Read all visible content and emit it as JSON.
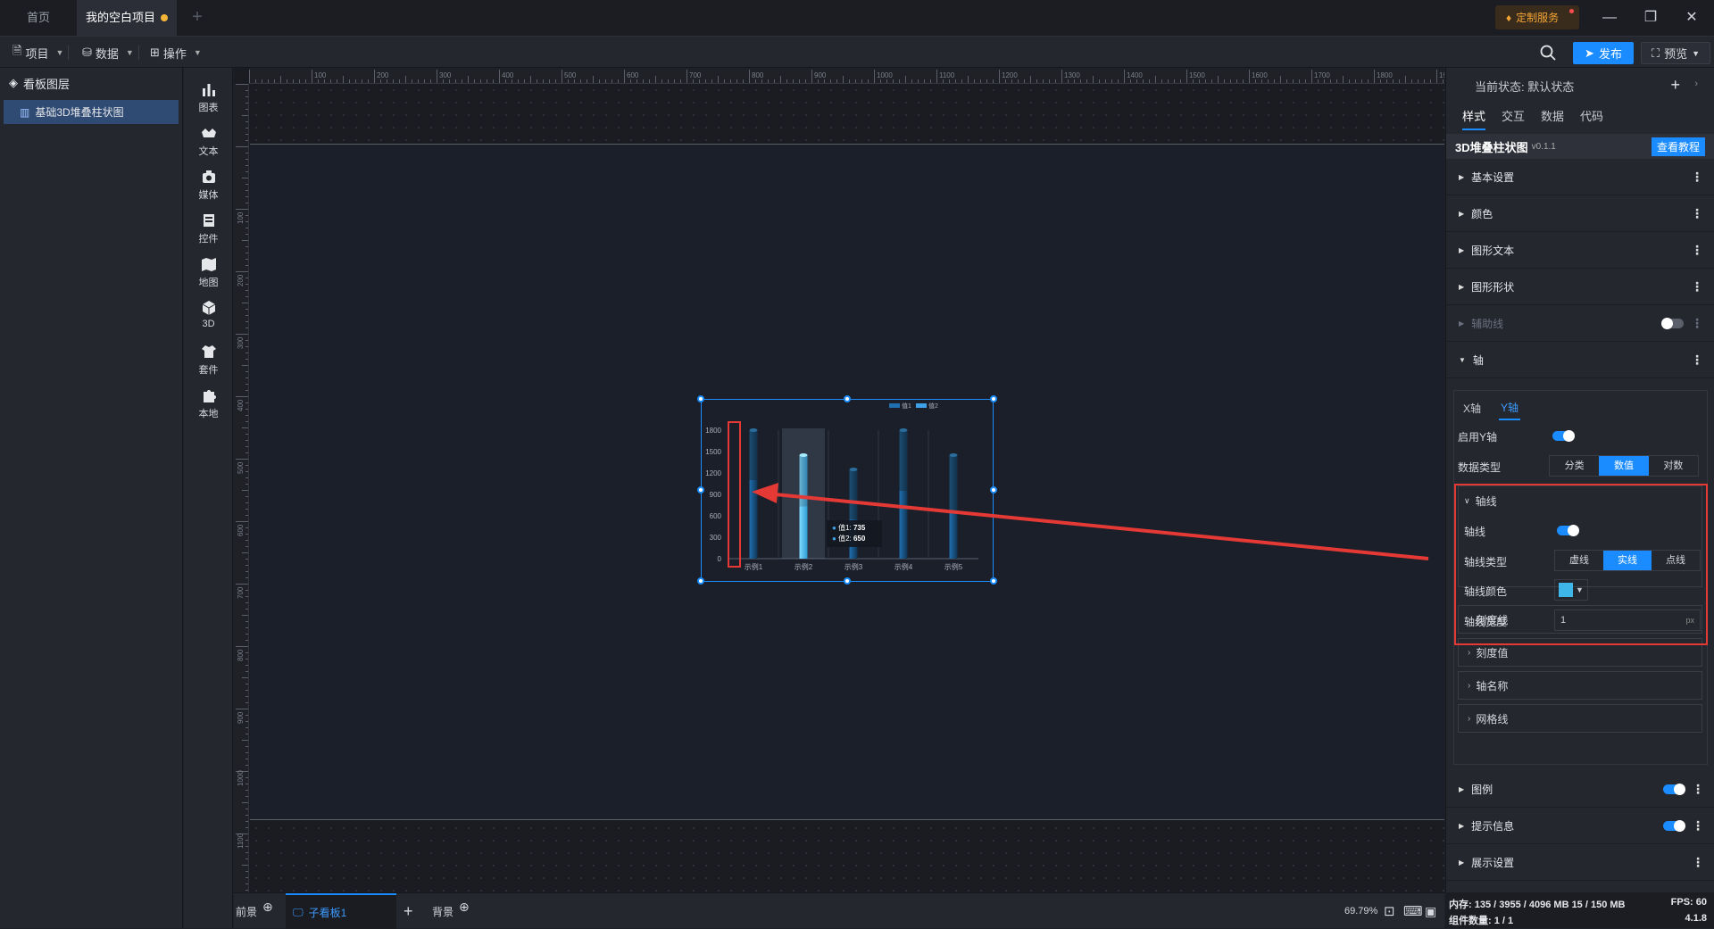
{
  "tabs": {
    "home": "首页",
    "project": "我的空白项目"
  },
  "header": {
    "custom_service": "定制服务",
    "publish": "发布",
    "preview": "预览"
  },
  "toolbar": {
    "project": "项目",
    "data": "数据",
    "operate": "操作"
  },
  "layers": {
    "title": "看板图层",
    "item": "基础3D堆叠柱状图"
  },
  "components": [
    "图表",
    "文本",
    "媒体",
    "控件",
    "地图",
    "3D",
    "套件",
    "本地"
  ],
  "ruler": {
    "top": [
      "100",
      "200",
      "300",
      "400",
      "500",
      "600",
      "700",
      "800",
      "900",
      "1000",
      "1100",
      "1200",
      "1300",
      "1400",
      "1500",
      "1600",
      "1700",
      "1800",
      "1900"
    ],
    "left": [
      "100",
      "200",
      "300",
      "400",
      "500",
      "600",
      "700",
      "800",
      "900",
      "1000",
      "1100",
      "1200"
    ]
  },
  "chart_data": {
    "type": "bar",
    "categories": [
      "示例1",
      "示例2",
      "示例3",
      "示例4",
      "示例5"
    ],
    "series": [
      {
        "name": "值1",
        "values": [
          1100,
          735,
          550,
          950,
          650
        ]
      },
      {
        "name": "值2",
        "values": [
          1800,
          1450,
          1250,
          1800,
          1450
        ]
      }
    ],
    "yticks": [
      "1800",
      "1500",
      "1200",
      "900",
      "600",
      "300",
      "0"
    ],
    "ylim": [
      0,
      1800
    ],
    "legend": [
      "值1",
      "值2"
    ],
    "tooltip": {
      "label1": "值1:",
      "value1": "735",
      "label2": "值2:",
      "value2": "650"
    },
    "highlight_category": "示例2"
  },
  "bottom": {
    "foreground": "前景",
    "subboard": "子看板1",
    "background": "背景",
    "zoom": "69.79%"
  },
  "panel": {
    "state": "当前状态: 默认状态",
    "tabs": [
      "样式",
      "交互",
      "数据",
      "代码"
    ],
    "component": "3D堆叠柱状图",
    "version": "v0.1.1",
    "tutorial": "查看教程",
    "sections": [
      "基本设置",
      "颜色",
      "图形文本",
      "图形形状",
      "辅助线",
      "轴"
    ],
    "axis_tabs": [
      "X轴",
      "Y轴"
    ],
    "enable_y": "启用Y轴",
    "data_type_label": "数据类型",
    "data_types": [
      "分类",
      "数值",
      "对数"
    ],
    "axis_line_group": "轴线",
    "axis_line_label": "轴线",
    "line_type_label": "轴线类型",
    "line_types": [
      "虚线",
      "实线",
      "点线"
    ],
    "line_color_label": "轴线颜色",
    "line_color": "#3fb6e8",
    "line_width_label": "轴线宽度",
    "line_width": "1",
    "unit": "px",
    "subs": [
      "刻度线",
      "刻度值",
      "轴名称",
      "网格线"
    ],
    "bottom_sections": [
      "图例",
      "提示信息",
      "展示设置"
    ]
  },
  "status": {
    "memory": "内存: 135 / 3955 / 4096 MB 15 / 150 MB",
    "fps": "FPS: 60",
    "count": "组件数量: 1 / 1",
    "version": "4.1.8"
  }
}
